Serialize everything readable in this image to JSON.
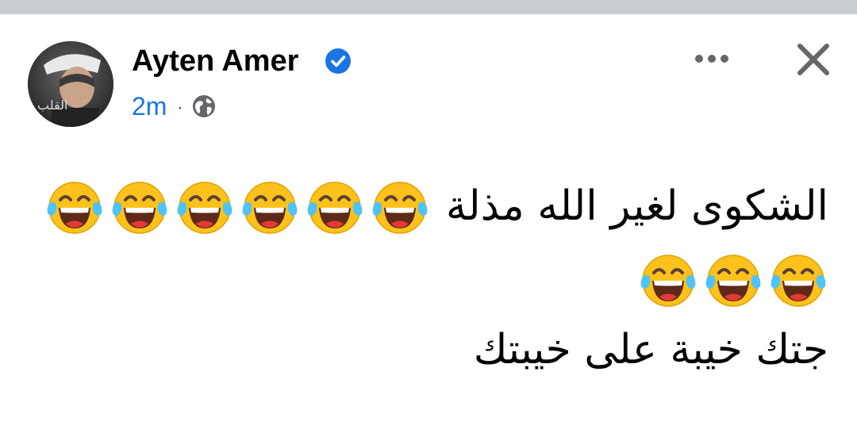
{
  "post": {
    "author": "Ayten Amer",
    "verified": true,
    "timestamp": "2m",
    "separator": "·",
    "privacy_icon": "globe-icon",
    "more_icon": "more-horizontal-icon",
    "close_icon": "close-icon",
    "text_line_1": "الشكوى لغير الله مذلة",
    "text_line_3": "جتك خيبة على خيبتك",
    "emoji_icon": "laughing-tears-emoji",
    "emoji_count_line_1": 6,
    "emoji_count_line_2": 3
  },
  "colors": {
    "top_bar": "#c9ccd1",
    "author": "#050505",
    "timestamp": "#1b74e4",
    "verified_badge": "#1b74e4",
    "icon_gray": "#65676b",
    "emoji_face": "#fcc21b",
    "emoji_tears": "#4fc3f7"
  }
}
